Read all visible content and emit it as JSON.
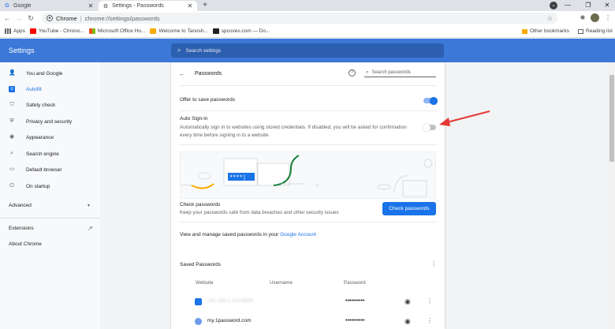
{
  "browser": {
    "tabs": [
      {
        "title": "Google",
        "icon": "google-g-icon"
      },
      {
        "title": "Settings - Passwords",
        "icon": "gear-icon"
      }
    ],
    "new_tab": "+",
    "omnibox": {
      "origin": "Chrome",
      "separator": "|",
      "url": "chrome://settings/passwords"
    },
    "bookmarks": [
      {
        "label": "Apps",
        "color": "#5f6368"
      },
      {
        "label": "YouTube - Chrono...",
        "color": "#ff0000"
      },
      {
        "label": "Microsoft Office Ho...",
        "color": "#f25022"
      },
      {
        "label": "Welcome to Tanosh...",
        "color": "#f9ab00"
      },
      {
        "label": "spcoves.com — Do...",
        "color": "#202124"
      }
    ],
    "bookmarks_right": [
      {
        "label": "Other bookmarks",
        "color": "#f9ab00"
      },
      {
        "label": "Reading list",
        "color": "#5f6368"
      }
    ]
  },
  "settings": {
    "header_title": "Settings",
    "search_placeholder": "Search settings",
    "sidebar": [
      {
        "label": "You and Google",
        "icon": "person-icon"
      },
      {
        "label": "Autofill",
        "icon": "autofill-icon",
        "active": true
      },
      {
        "label": "Safety check",
        "icon": "shield-check-icon"
      },
      {
        "label": "Privacy and security",
        "icon": "shield-icon"
      },
      {
        "label": "Appearance",
        "icon": "palette-icon"
      },
      {
        "label": "Search engine",
        "icon": "search-icon"
      },
      {
        "label": "Default browser",
        "icon": "browser-icon"
      },
      {
        "label": "On startup",
        "icon": "power-icon"
      }
    ],
    "advanced": "Advanced",
    "extensions": "Extensions",
    "about": "About Chrome"
  },
  "passwords": {
    "title": "Passwords",
    "search_placeholder": "Search passwords",
    "offer_to_save": {
      "label": "Offer to save passwords",
      "enabled": true
    },
    "auto_signin": {
      "title": "Auto Sign-in",
      "description": "Automatically sign in to websites using stored credentials. If disabled, you will be asked for confirmation every time before signing in to a website.",
      "enabled": false
    },
    "illustration_password": "****|",
    "check": {
      "title": "Check passwords",
      "description": "Keep your passwords safe from data breaches and other security issues",
      "button": "Check passwords"
    },
    "view_manage": {
      "prefix": "View and manage saved passwords in your ",
      "link": "Google Account"
    },
    "saved": {
      "title": "Saved Passwords",
      "columns": [
        "Website",
        "Username",
        "Password"
      ],
      "rows": [
        {
          "site": "192.168.1.100:8006",
          "password": "••••••••••",
          "blurred": true,
          "favicon": "#1a73e8"
        },
        {
          "site": "my.1password.com",
          "password": "••••••••••",
          "blurred": false,
          "favicon": "#6b9be8"
        }
      ]
    }
  },
  "colors": {
    "accent": "#1a73e8",
    "header": "#3c78d8",
    "annotation": "#e53935"
  }
}
